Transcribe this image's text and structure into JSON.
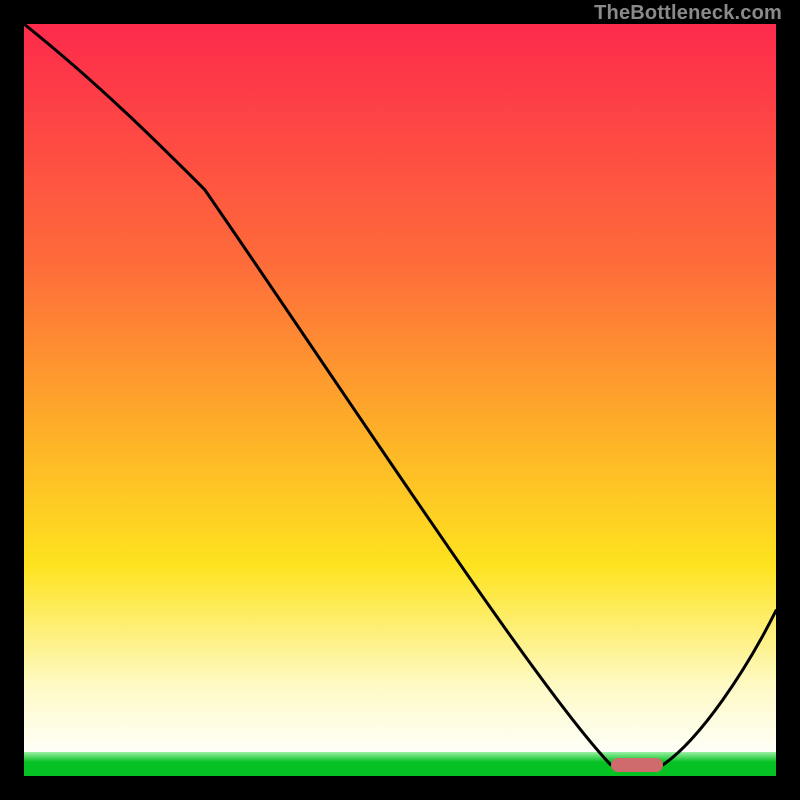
{
  "watermark": "TheBottleneck.com",
  "colors": {
    "gradient_top": "#fd2a4c",
    "gradient_mid1": "#fe6c3a",
    "gradient_mid2": "#feb228",
    "gradient_mid3": "#fee31f",
    "gradient_pale": "#fefac5",
    "gradient_white": "#ffffff",
    "green_light": "#9bf0a5",
    "green_dark": "#06c123",
    "curve": "#000000",
    "marker": "#cf6b6c",
    "border": "#000000"
  },
  "chart_data": {
    "type": "line",
    "title": "",
    "xlabel": "",
    "ylabel": "",
    "x": [
      0.0,
      0.24,
      0.78,
      0.79,
      0.85,
      1.0
    ],
    "values": [
      1.0,
      0.78,
      0.015,
      0.015,
      0.015,
      0.22
    ],
    "xlim": [
      0,
      1
    ],
    "ylim": [
      0,
      1
    ],
    "marker": {
      "x_start": 0.78,
      "x_end": 0.85,
      "y": 0.015
    },
    "notes": "No axis tick labels are visible. Background is a vertical gradient from red (top) through orange/yellow to pale then white, with a thin green band near y≈0. Curve is black; a short horizontal pink/rose bar sits on the flat bottom section near the optimum."
  }
}
